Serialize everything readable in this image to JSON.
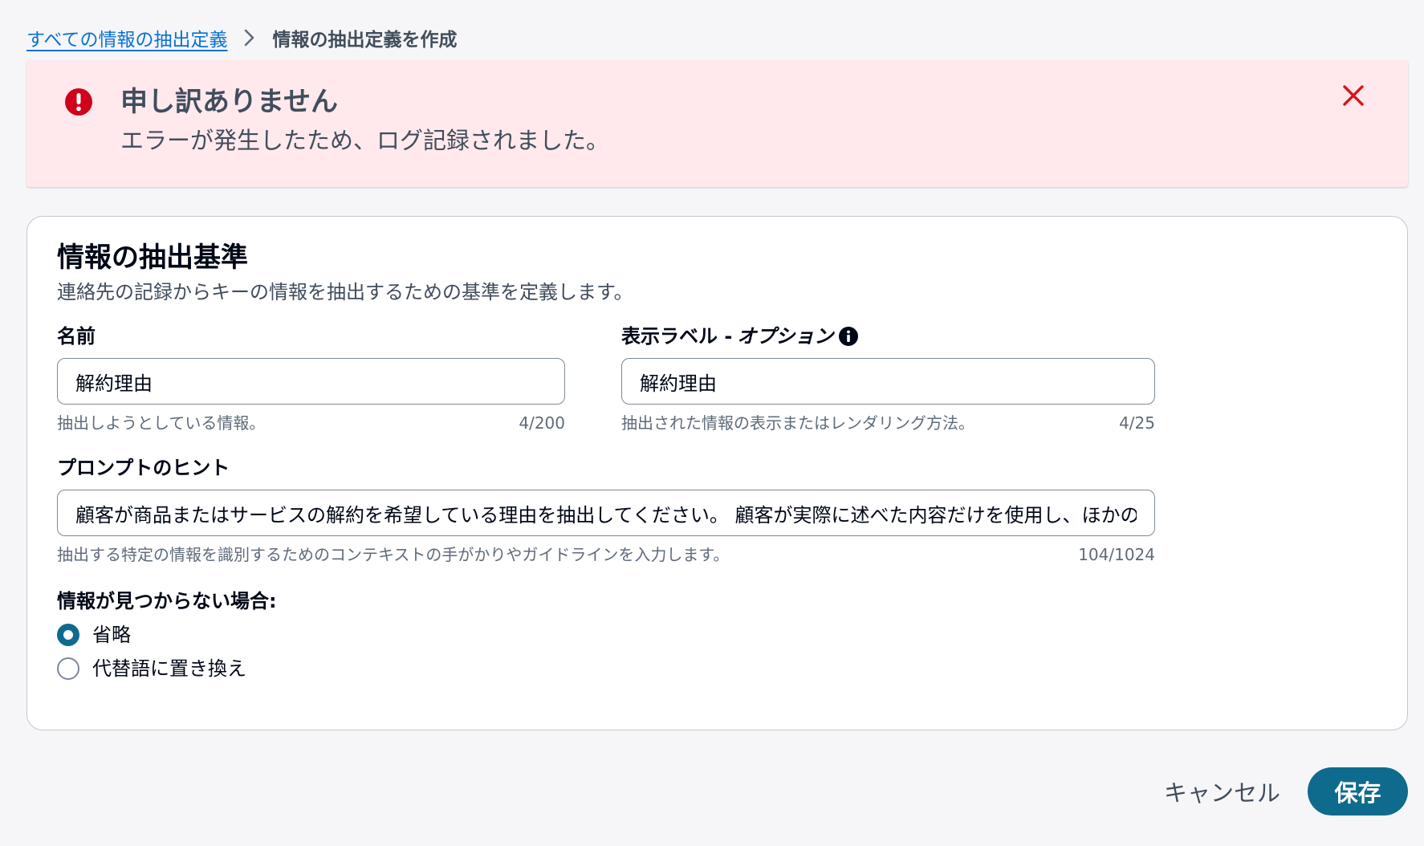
{
  "breadcrumb": {
    "parent": "すべての情報の抽出定義",
    "current": "情報の抽出定義を作成"
  },
  "alert": {
    "title": "申し訳ありません",
    "message": "エラーが発生したため、ログ記録されました。",
    "colors": {
      "background": "#ffe9ec",
      "icon": "#d0021b",
      "close": "#d91515"
    }
  },
  "section": {
    "title": "情報の抽出基準",
    "description": "連絡先の記録からキーの情報を抽出するための基準を定義します。"
  },
  "fields": {
    "name": {
      "label": "名前",
      "value": "解約理由",
      "hint": "抽出しようとしている情報。",
      "count": "4/200"
    },
    "display_label": {
      "label": "表示ラベル - ",
      "label_optional": "オプション",
      "value": "解約理由",
      "hint": "抽出された情報の表示またはレンダリング方法。",
      "count": "4/25"
    },
    "prompt_hint": {
      "label": "プロンプトのヒント",
      "value": "顧客が商品またはサービスの解約を希望している理由を抽出してください。 顧客が実際に述べた内容だけを使用し、ほかの情報を推測しないでください。",
      "hint": "抽出する特定の情報を識別するためのコンテキストの手がかりやガイドラインを入力します。",
      "count": "104/1024"
    }
  },
  "not_found": {
    "label": "情報が見つからない場合:",
    "options": [
      {
        "label": "省略",
        "checked": true
      },
      {
        "label": "代替語に置き換え",
        "checked": false
      }
    ]
  },
  "actions": {
    "cancel": "キャンセル",
    "save": "保存",
    "primary_color": "#0f6b8e"
  }
}
